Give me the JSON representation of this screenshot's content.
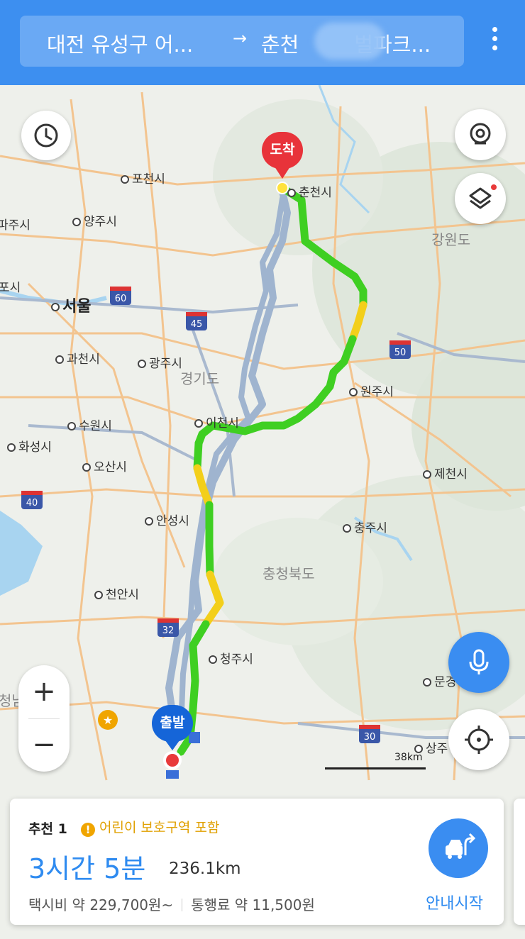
{
  "header": {
    "origin": "대전 유성구 어...",
    "arrow": "→",
    "destination": "춘천",
    "destination_tail": "벌파크..."
  },
  "map": {
    "labels": {
      "pocheon": "포천시",
      "yangju": "양주시",
      "paju": "파주시",
      "seoul": "서울",
      "gimpo": "포시",
      "gwacheon": "과천시",
      "gwangju": "광주시",
      "gyeonggi": "경기도",
      "suwon": "수원시",
      "hwaseong": "화성시",
      "osan": "오산시",
      "icheon": "이천시",
      "chuncheon": "춘천시",
      "gangwon": "강원도",
      "wonju": "원주시",
      "jecheon": "제천시",
      "chungju": "충주시",
      "chungbuk": "충청북도",
      "anseong": "안성시",
      "cheonan": "천안시",
      "cheongju": "청주시",
      "mungyeong": "문경",
      "sangju": "상주",
      "chungnam": "청남"
    },
    "highways": [
      "60",
      "45",
      "50",
      "40",
      "32",
      "30"
    ],
    "pins": {
      "arrival": "도착",
      "departure": "출발"
    },
    "scale": "38km",
    "colors": {
      "route_green": "#3fcf22",
      "route_yellow": "#f3cf1a",
      "alt_route": "#9fb4cf",
      "arrival_pin": "#e8333a",
      "departure_pin": "#1565d8"
    }
  },
  "route_card": {
    "tag": "추천 1",
    "warning": "어린이 보호구역 포함",
    "eta": "3시간 5분",
    "distance": "236.1km",
    "taxi_fare": "택시비 약 229,700원~",
    "toll": "통행료 약 11,500원",
    "start_label": "안내시작"
  },
  "icons": [
    "history-icon",
    "street-view-icon",
    "layers-icon",
    "mic-icon",
    "location-icon",
    "zoom-in-icon",
    "zoom-out-icon",
    "car-route-icon",
    "more-icon",
    "warning-icon"
  ]
}
